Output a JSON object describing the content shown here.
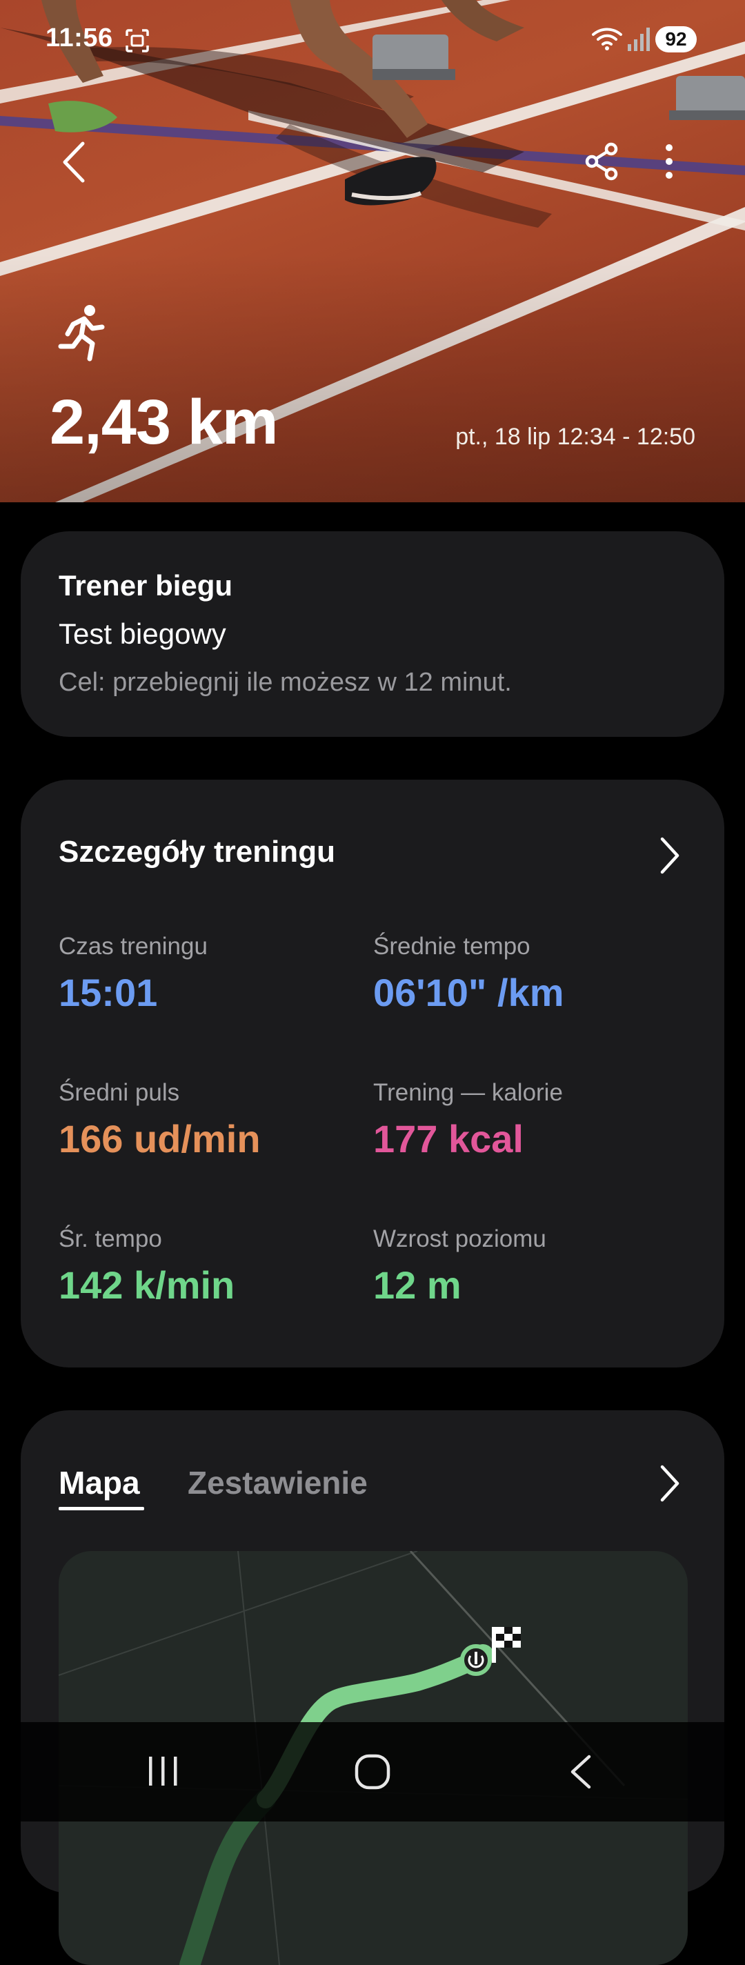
{
  "status_bar": {
    "time": "11:56",
    "battery": "92",
    "icons": [
      "screenshot-icon",
      "wifi-icon",
      "signal-icon",
      "battery-icon"
    ]
  },
  "header": {
    "actions": [
      "back-arrow-icon",
      "share-icon",
      "more-vertical-icon"
    ],
    "activity_icon": "running-icon",
    "distance": "2,43 km",
    "date_range": "pt., 18 lip 12:34 - 12:50"
  },
  "coach": {
    "title": "Trener biegu",
    "program": "Test biegowy",
    "goal": "Cel: przebiegnij ile możesz w 12 minut."
  },
  "details": {
    "title": "Szczegóły treningu",
    "stats": [
      {
        "label": "Czas treningu",
        "value": "15:01",
        "color": "#6c9cf2"
      },
      {
        "label": "Średnie tempo",
        "value": "06'10\" /km",
        "color": "#6c9cf2"
      },
      {
        "label": "Średni puls",
        "value": "166 ud/min",
        "color": "#e5915a"
      },
      {
        "label": "Trening — kalorie",
        "value": "177 kcal",
        "color": "#e2579a"
      },
      {
        "label": "Śr. tempo",
        "value": "142 k/min",
        "color": "#6fd68a"
      },
      {
        "label": "Wzrost poziomu",
        "value": "12 m",
        "color": "#6fd68a"
      }
    ]
  },
  "map_card": {
    "tabs": [
      {
        "label": "Mapa",
        "active": true
      },
      {
        "label": "Zestawienie",
        "active": false
      }
    ],
    "route_color": "#7fd08c",
    "markers": [
      "start-icon",
      "finish-flag-icon"
    ]
  },
  "nav": {
    "buttons": [
      "recent-apps-icon",
      "home-icon",
      "back-icon"
    ]
  },
  "colors": {
    "background": "#000000",
    "card": "#1b1b1d",
    "track": "#a9462b"
  }
}
